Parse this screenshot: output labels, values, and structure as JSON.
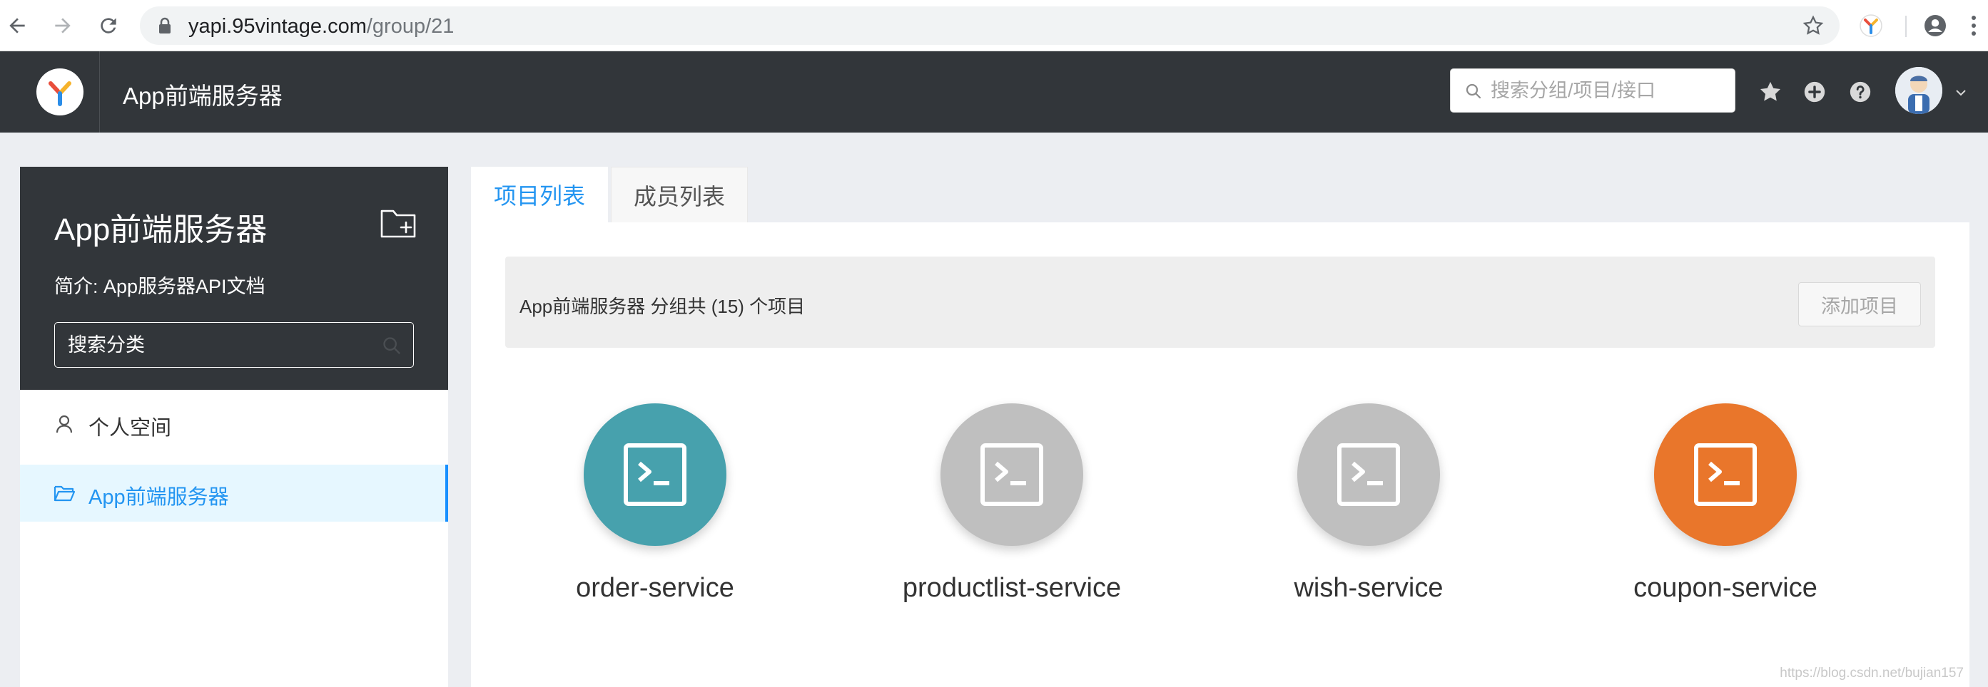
{
  "browser": {
    "url_host": "yapi.95vintage.com",
    "url_path": "/group/21"
  },
  "header": {
    "title": "App前端服务器",
    "search_placeholder": "搜索分组/项目/接口"
  },
  "sidebar": {
    "group_title": "App前端服务器",
    "description": "简介: App服务器API文档",
    "search_placeholder": "搜索分类",
    "items": [
      {
        "label": "个人空间",
        "icon": "user-icon"
      },
      {
        "label": "App前端服务器",
        "icon": "folder-icon",
        "active": true
      }
    ]
  },
  "tabs": [
    {
      "label": "项目列表",
      "active": true
    },
    {
      "label": "成员列表",
      "active": false
    }
  ],
  "main": {
    "summary": "App前端服务器 分组共 (15) 个项目",
    "add_button": "添加项目"
  },
  "projects": [
    {
      "name": "order-service",
      "color": "#47a1ad"
    },
    {
      "name": "productlist-service",
      "color": "#bfbfbf"
    },
    {
      "name": "wish-service",
      "color": "#bfbfbf"
    },
    {
      "name": "coupon-service",
      "color": "#e9762b"
    }
  ],
  "watermark": "https://blog.csdn.net/bujian157",
  "colors": {
    "header_bg": "#32363a",
    "accent": "#2395f1",
    "active_item_bg": "#e6f7ff"
  }
}
